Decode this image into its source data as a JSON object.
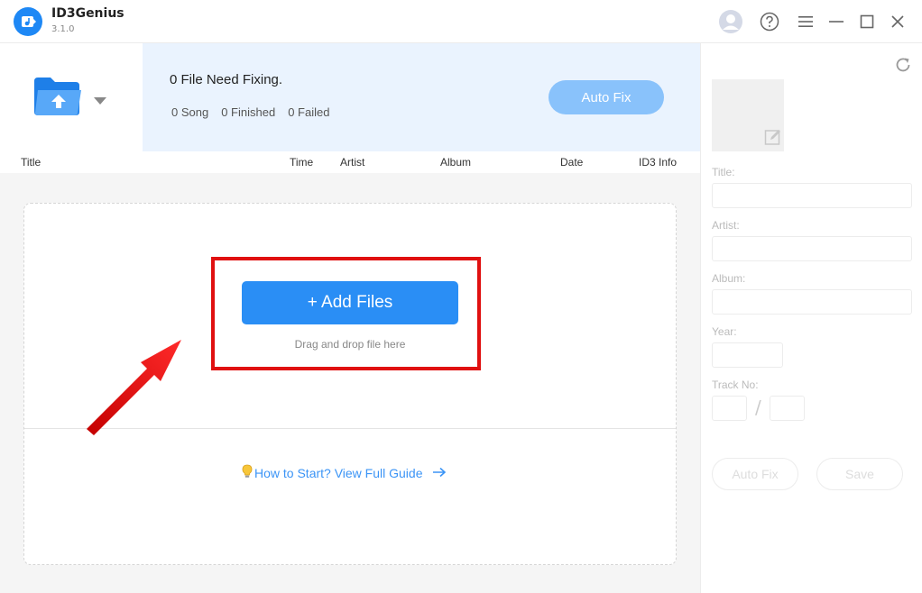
{
  "app": {
    "name": "ID3Genius",
    "version": "3.1.0"
  },
  "window_controls": [
    "avatar-icon",
    "help-icon",
    "menu-icon",
    "minimize-icon",
    "maximize-icon",
    "close-icon"
  ],
  "status": {
    "title": "0 File Need Fixing.",
    "songs": "0 Song",
    "finished": "0 Finished",
    "failed": "0 Failed",
    "auto_fix_label": "Auto Fix"
  },
  "table": {
    "columns": [
      "Title",
      "Time",
      "Artist",
      "Album",
      "Date",
      "ID3 Info"
    ]
  },
  "drop_zone": {
    "add_files_label": "+ Add Files",
    "drag_hint": "Drag and drop file here",
    "guide_label": "How to Start? View Full Guide"
  },
  "editor": {
    "title_label": "Title:",
    "artist_label": "Artist:",
    "album_label": "Album:",
    "year_label": "Year:",
    "track_label": "Track No:",
    "track_separator": "/",
    "auto_fix_label": "Auto Fix",
    "save_label": "Save"
  },
  "colors": {
    "accent": "#2a8ef5",
    "status_bg": "#eaf3fe",
    "highlight": "#e01010"
  }
}
